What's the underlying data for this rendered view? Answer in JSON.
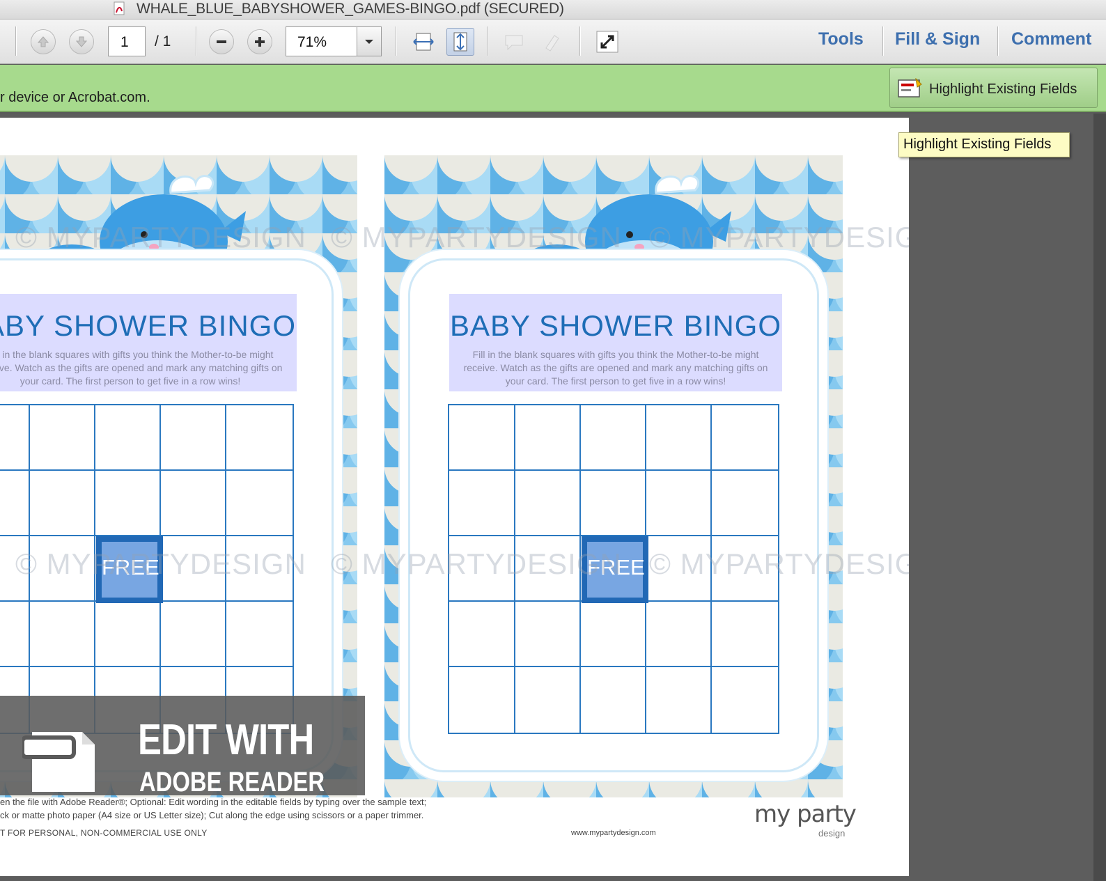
{
  "window": {
    "title": "WHALE_BLUE_BABYSHOWER_GAMES-BINGO.pdf (SECURED)"
  },
  "toolbar": {
    "page_current": "1",
    "page_total": "/ 1",
    "zoom": "71%",
    "tools_label": "Tools",
    "fill_sign_label": "Fill & Sign",
    "comment_label": "Comment"
  },
  "notification": {
    "message": "r device or Acrobat.com.",
    "highlight_button": "Highlight Existing Fields",
    "accent": "#a7da8d"
  },
  "tooltip": {
    "text": "Highlight Existing Fields"
  },
  "document": {
    "cards": [
      {
        "title": "BABY SHOWER BINGO",
        "desc": "Fill in the blank squares with gifts you think the Mother-to-be might receive. Watch as the gifts are opened and mark any matching gifts on your card. The first person to get five in a row wins!",
        "free": "FREE"
      },
      {
        "title": "BABY SHOWER BINGO",
        "desc": "Fill in the blank squares with gifts you think the Mother-to-be might receive. Watch as the gifts are opened and mark any matching gifts on your card. The first person to get five in a row wins!",
        "free": "FREE"
      }
    ],
    "watermark": "© MYPARTYDESIGN",
    "banner": {
      "line1": "EDIT WITH",
      "line2": "ADOBE READER"
    },
    "footer": {
      "line1": "en the file with Adobe Reader®; Optional: Edit wording in the editable fields by typing over the sample text;",
      "line2": "ck or matte photo paper (A4 size or US Letter size); Cut along the edge using scissors or a paper trimmer.",
      "line3": "T FOR PERSONAL, NON-COMMERCIAL USE ONLY",
      "url": "www.mypartydesign.com",
      "brand": "my party",
      "brand_sub": "design"
    }
  },
  "colors": {
    "link": "#3d6fae",
    "bingo_blue": "#2a78c0",
    "title_blue": "#1e6db6"
  }
}
